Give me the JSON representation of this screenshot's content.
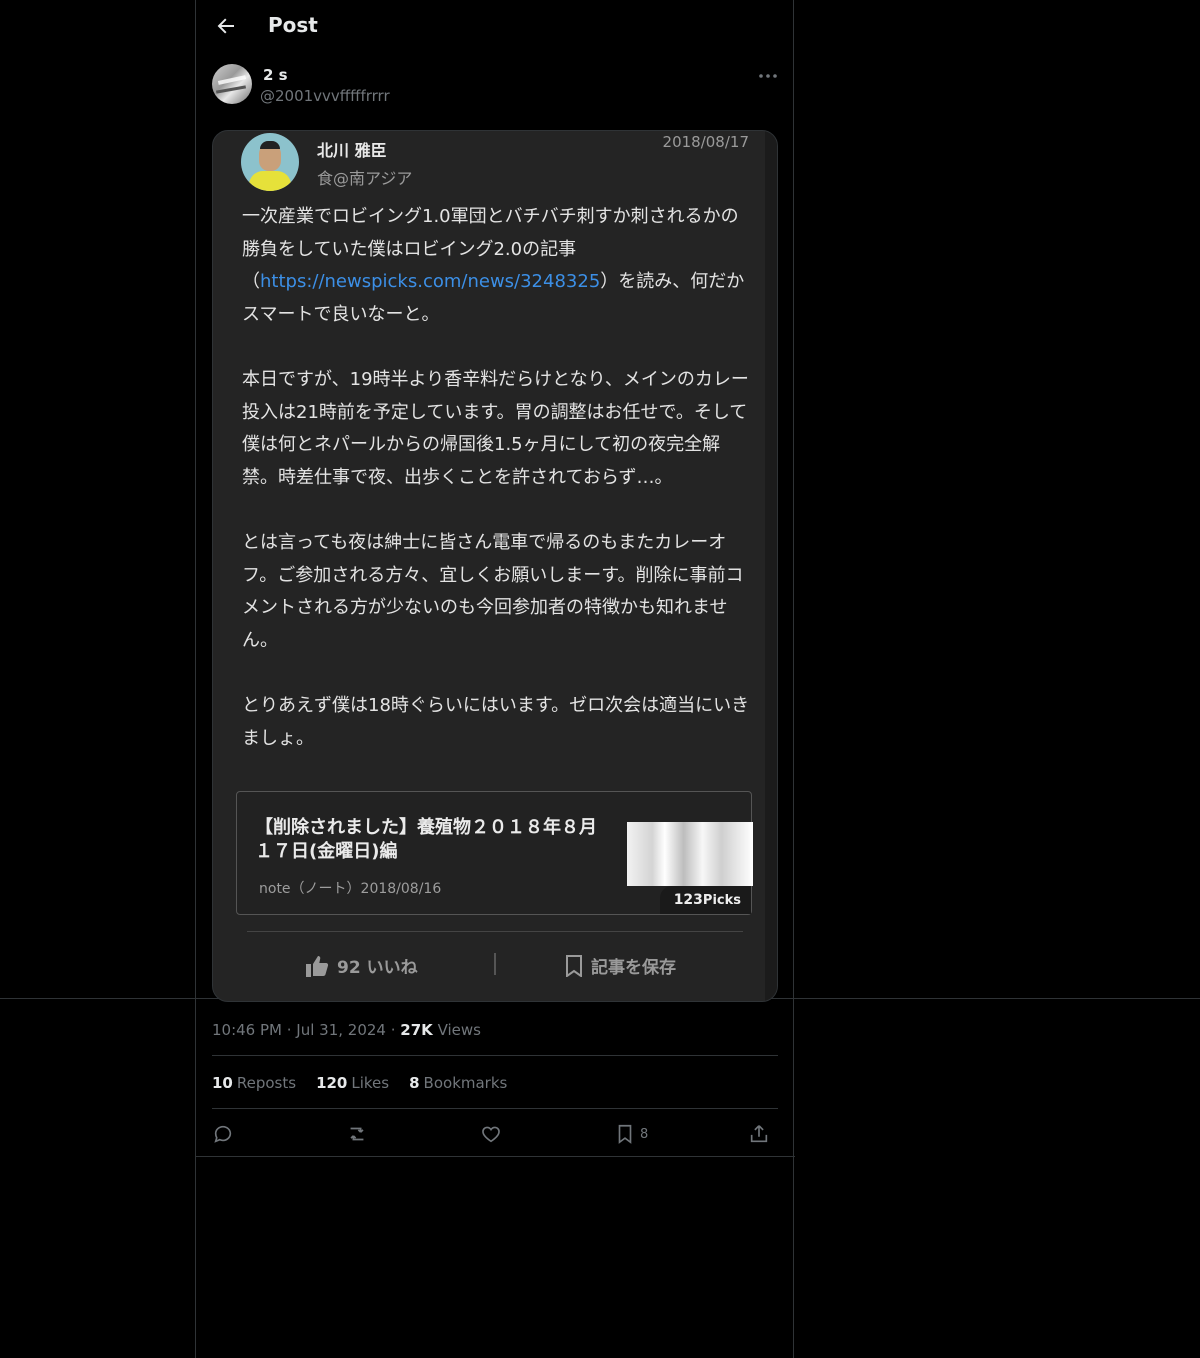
{
  "header": {
    "title": "Post"
  },
  "author": {
    "name": "2 s",
    "handle": "@2001vvvfffffrrrr"
  },
  "embedded_post": {
    "author_name": "北川 雅臣",
    "author_sub": "食@南アジア",
    "date": "2018/08/17",
    "para1_a": "一次産業でロビイング1.0軍団とバチバチ刺すか刺されるかの勝負をしていた僕はロビイング2.0の記事（",
    "para1_link": "https://newspicks.com/news/3248325",
    "para1_b": "）を読み、何だかスマートで良いなーと。",
    "para2": "本日ですが、19時半より香辛料だらけとなり、メインのカレー投入は21時前を予定しています。胃の調整はお任せで。そして僕は何とネパールからの帰国後1.5ヶ月にして初の夜完全解禁。時差仕事で夜、出歩くことを許されておらず…。",
    "para3": "とは言っても夜は紳士に皆さん電車で帰るのもまたカレーオフ。ご参加される方々、宜しくお願いしまーす。削除に事前コメントされる方が少ないのも今回参加者の特徴かも知れません。",
    "para4": "とりあえず僕は18時ぐらいにはいます。ゼロ次会は適当にいきましょ。",
    "card": {
      "title": "【削除されました】養殖物２０１８年８月１７日(金曜日)編",
      "meta": "note（ノート）2018/08/16",
      "picks_count": "123",
      "picks_label": "Picks"
    },
    "like_label": "92 いいね",
    "save_label": "記事を保存"
  },
  "meta": {
    "time": "10:46 PM",
    "date": "Jul 31, 2024",
    "views_count": "27K",
    "views_label": "Views"
  },
  "stats": {
    "reposts_count": "10",
    "reposts_label": "Reposts",
    "likes_count": "120",
    "likes_label": "Likes",
    "bookmarks_count": "8",
    "bookmarks_label": "Bookmarks"
  },
  "actions": {
    "bookmark_count": "8"
  },
  "colors": {
    "background": "#000000",
    "border": "#2f3336",
    "secondary_text": "#71767b",
    "link": "#3c8fe6"
  }
}
